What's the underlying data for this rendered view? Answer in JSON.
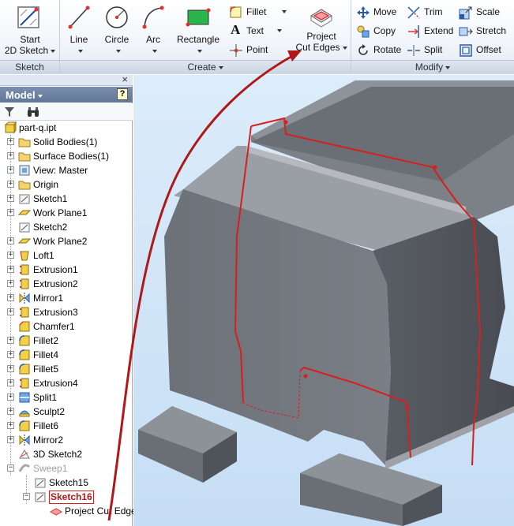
{
  "ribbon": {
    "sketch_panel": {
      "title": "Sketch",
      "start_sketch_line1": "Start",
      "start_sketch_line2": "2D Sketch"
    },
    "create_panel": {
      "title": "Create",
      "line": "Line",
      "circle": "Circle",
      "arc": "Arc",
      "rectangle": "Rectangle",
      "fillet": "Fillet",
      "text": "Text",
      "point": "Point",
      "project_line1": "Project",
      "project_line2": "Cut Edges"
    },
    "modify_panel": {
      "title": "Modify",
      "move": "Move",
      "copy": "Copy",
      "rotate": "Rotate",
      "trim": "Trim",
      "extend": "Extend",
      "split": "Split",
      "scale": "Scale",
      "stretch": "Stretch",
      "offset": "Offset"
    }
  },
  "browser": {
    "close": "×",
    "title": "Model",
    "help": "?",
    "tree": [
      {
        "label": "part-q.ipt",
        "icon": "part-icon"
      },
      {
        "label": "Solid Bodies(1)",
        "icon": "folder-icon"
      },
      {
        "label": "Surface Bodies(1)",
        "icon": "folder-icon"
      },
      {
        "label": "View: Master",
        "icon": "view-icon"
      },
      {
        "label": "Origin",
        "icon": "folder-icon"
      },
      {
        "label": "Sketch1",
        "icon": "sketch-icon"
      },
      {
        "label": "Work Plane1",
        "icon": "workplane-icon"
      },
      {
        "label": "Sketch2",
        "icon": "sketch-icon"
      },
      {
        "label": "Work Plane2",
        "icon": "workplane-icon"
      },
      {
        "label": "Loft1",
        "icon": "loft-icon"
      },
      {
        "label": "Extrusion1",
        "icon": "extrusion-icon"
      },
      {
        "label": "Extrusion2",
        "icon": "extrusion-icon"
      },
      {
        "label": "Mirror1",
        "icon": "mirror-icon"
      },
      {
        "label": "Extrusion3",
        "icon": "extrusion-icon"
      },
      {
        "label": "Chamfer1",
        "icon": "chamfer-icon"
      },
      {
        "label": "Fillet2",
        "icon": "fillet-icon"
      },
      {
        "label": "Fillet4",
        "icon": "fillet-icon"
      },
      {
        "label": "Fillet5",
        "icon": "fillet-icon"
      },
      {
        "label": "Extrusion4",
        "icon": "extrusion-icon"
      },
      {
        "label": "Split1",
        "icon": "split-icon"
      },
      {
        "label": "Sculpt2",
        "icon": "sculpt-icon"
      },
      {
        "label": "Fillet6",
        "icon": "fillet-icon"
      },
      {
        "label": "Mirror2",
        "icon": "mirror-icon"
      },
      {
        "label": "3D Sketch2",
        "icon": "sketch3d-icon"
      },
      {
        "label": "Sweep1",
        "icon": "sweep-icon"
      },
      {
        "label": "Sketch15",
        "icon": "sketch-icon"
      },
      {
        "label": "Sketch16",
        "icon": "sketch-icon"
      },
      {
        "label": "Project Cut Edge",
        "icon": "project-cut-edge-icon"
      }
    ]
  },
  "colors": {
    "accent_red": "#d62020",
    "arrow_red": "#b01818",
    "model_grey": "#8b8f96",
    "viewport_sky": "#c6def5"
  }
}
